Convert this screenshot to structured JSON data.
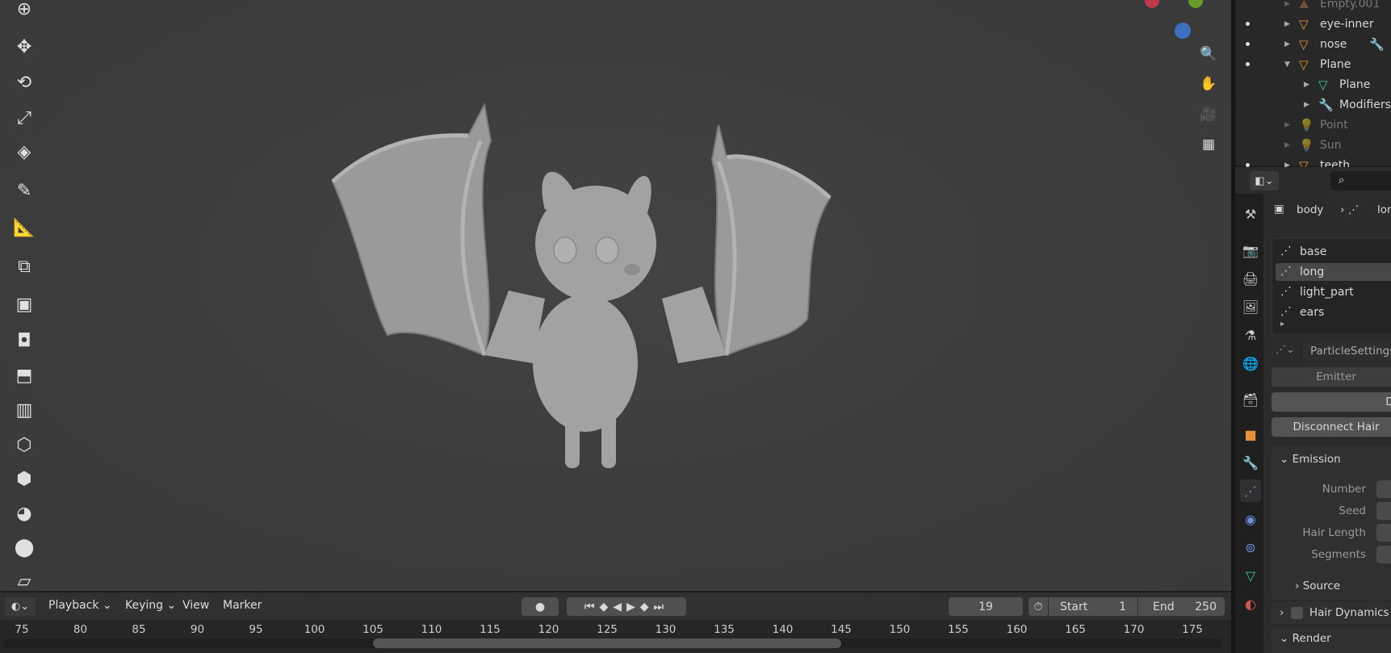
{
  "toolbar": {
    "tools": [
      {
        "name": "cursor-icon",
        "glyph": "⊕"
      },
      {
        "name": "move-icon",
        "glyph": "✥"
      },
      {
        "name": "rotate-icon",
        "glyph": "⟲"
      },
      {
        "name": "scale-icon",
        "glyph": "⤢"
      },
      {
        "name": "transform-icon",
        "glyph": "◈"
      },
      {
        "name": "annotate-icon",
        "glyph": "✎"
      },
      {
        "name": "measure-icon",
        "glyph": "📐"
      },
      {
        "name": "add-cube-icon",
        "glyph": "⧉"
      },
      {
        "name": "extrude-icon",
        "glyph": "▣"
      },
      {
        "name": "inset-icon",
        "glyph": "◘"
      },
      {
        "name": "bevel-icon",
        "glyph": "⬒"
      },
      {
        "name": "loop-cut-icon",
        "glyph": "▥"
      },
      {
        "name": "knife-icon",
        "glyph": "⬡"
      },
      {
        "name": "poly-build-icon",
        "glyph": "⬢"
      },
      {
        "name": "spin-icon",
        "glyph": "◕"
      },
      {
        "name": "smooth-icon",
        "glyph": "⬤"
      },
      {
        "name": "shear-icon",
        "glyph": "▱"
      }
    ]
  },
  "nav": [
    {
      "name": "zoom-icon",
      "glyph": "🔍"
    },
    {
      "name": "pan-hand-icon",
      "glyph": "✋"
    },
    {
      "name": "camera-icon",
      "glyph": "🎥"
    },
    {
      "name": "grid-icon",
      "glyph": "▦"
    }
  ],
  "outliner": {
    "rows": [
      {
        "label": "Empty.001",
        "icon": "empty-icon",
        "glyph": "⛰",
        "color": "#c8814a",
        "dim": true,
        "dot": false,
        "indent": 0,
        "expanded": false
      },
      {
        "label": "eye-inner",
        "icon": "mesh-object-icon",
        "glyph": "▽",
        "color": "#e8923a",
        "dim": false,
        "dot": true,
        "indent": 0,
        "expanded": false
      },
      {
        "label": "nose",
        "icon": "mesh-object-icon",
        "glyph": "▽",
        "color": "#e8923a",
        "dim": false,
        "dot": true,
        "indent": 0,
        "expanded": false,
        "extra": "🔧"
      },
      {
        "label": "Plane",
        "icon": "mesh-object-icon",
        "glyph": "▽",
        "color": "#e8923a",
        "dim": false,
        "dot": true,
        "indent": 0,
        "expanded": true
      },
      {
        "label": "Plane",
        "icon": "mesh-data-icon",
        "glyph": "▽",
        "color": "#3fc9a0",
        "dim": false,
        "dot": false,
        "indent": 1,
        "expanded": false
      },
      {
        "label": "Modifiers",
        "icon": "wrench-icon",
        "glyph": "🔧",
        "color": "#6b8fdb",
        "dim": false,
        "dot": false,
        "indent": 1,
        "expanded": false
      },
      {
        "label": "Point",
        "icon": "light-icon",
        "glyph": "💡",
        "color": "#c8814a",
        "dim": true,
        "dot": false,
        "indent": 0,
        "expanded": false
      },
      {
        "label": "Sun",
        "icon": "light-icon",
        "glyph": "💡",
        "color": "#c8814a",
        "dim": true,
        "dot": false,
        "indent": 0,
        "expanded": false
      },
      {
        "label": "teeth",
        "icon": "mesh-object-icon",
        "glyph": "▽",
        "color": "#e8923a",
        "dim": false,
        "dot": true,
        "indent": 0,
        "expanded": false
      }
    ]
  },
  "properties": {
    "breadcrumb": {
      "object": "body",
      "system": "lon"
    },
    "particle_systems": [
      "base",
      "long",
      "light_part",
      "ears"
    ],
    "active_system": "long",
    "settings_name": "ParticleSettings",
    "emitter_label": "Emitter",
    "de_label": "De",
    "disconnect_label": "Disconnect Hair",
    "emission": {
      "title": "Emission",
      "fields": [
        "Number",
        "Seed",
        "Hair Length",
        "Segments"
      ],
      "source": "Source"
    },
    "hair_dynamics": "Hair Dynamics",
    "render": "Render",
    "tabs": [
      {
        "name": "tool-tab-icon",
        "glyph": "⚒",
        "color": "#ccc"
      },
      {
        "name": "render-tab-icon",
        "glyph": "📷",
        "color": "#ccc"
      },
      {
        "name": "output-tab-icon",
        "glyph": "🖨",
        "color": "#ccc"
      },
      {
        "name": "view-layer-tab-icon",
        "glyph": "🖼",
        "color": "#ccc"
      },
      {
        "name": "scene-tab-icon",
        "glyph": "⚗",
        "color": "#ccc"
      },
      {
        "name": "world-tab-icon",
        "glyph": "🌐",
        "color": "#d0584f"
      },
      {
        "name": "collection-tab-icon",
        "glyph": "🗃",
        "color": "#ccc"
      },
      {
        "name": "object-tab-icon",
        "glyph": "■",
        "color": "#e8923a"
      },
      {
        "name": "modifier-tab-icon",
        "glyph": "🔧",
        "color": "#6b8fdb"
      },
      {
        "name": "particles-tab-icon",
        "glyph": "⋰",
        "color": "#6b8fdb",
        "active": true
      },
      {
        "name": "physics-tab-icon",
        "glyph": "◉",
        "color": "#6b8fdb"
      },
      {
        "name": "constraints-tab-icon",
        "glyph": "⊚",
        "color": "#6b8fdb"
      },
      {
        "name": "data-tab-icon",
        "glyph": "▽",
        "color": "#3fc9a0"
      },
      {
        "name": "material-tab-icon",
        "glyph": "◐",
        "color": "#d0584f"
      }
    ]
  },
  "timeline": {
    "menus": [
      "Playback",
      "Keying",
      "View",
      "Marker"
    ],
    "current_frame": "19",
    "start_label": "Start",
    "start": "1",
    "end_label": "End",
    "end": "250",
    "ticks": [
      "75",
      "80",
      "85",
      "90",
      "95",
      "100",
      "105",
      "110",
      "115",
      "120",
      "125",
      "130",
      "135",
      "140",
      "145",
      "150",
      "155",
      "160",
      "165",
      "170",
      "175"
    ],
    "scroll_range": [
      105,
      145
    ]
  }
}
